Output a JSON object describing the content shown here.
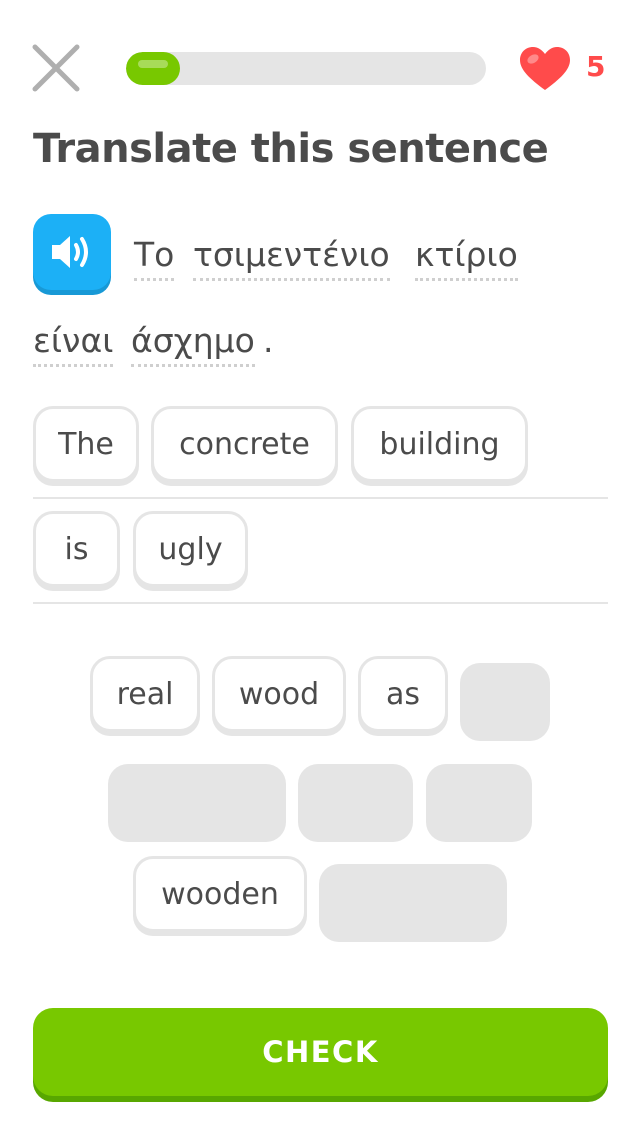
{
  "header": {
    "close_icon": "close-icon",
    "progress": 0.15,
    "hearts_count": "5",
    "colors": {
      "progress": "#78c800",
      "heart": "#ff4b4b"
    }
  },
  "prompt": {
    "instruction": "Translate this sentence",
    "speaker_icon": "speaker-icon",
    "words": [
      "Το",
      "τσιμεντένιο",
      "κτίριο",
      "είναι",
      "άσχημο"
    ],
    "punctuation": "."
  },
  "answer": {
    "selected_words": [
      "The",
      "concrete",
      "building",
      "is",
      "ugly"
    ]
  },
  "word_bank": {
    "available_words": [
      "real",
      "wood",
      "as",
      "wooden"
    ],
    "used_slot_count": 5
  },
  "check_button": {
    "label": "CHECK",
    "color": "#78c800"
  }
}
